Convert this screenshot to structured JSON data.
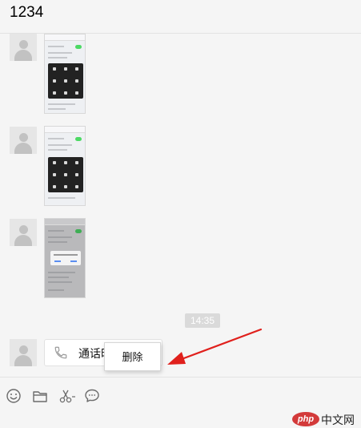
{
  "chat": {
    "title": "1234",
    "timestamp": "14:35",
    "call_message": "通话时长"
  },
  "context_menu": {
    "delete_label": "删除"
  },
  "toolbar": {
    "icons": [
      "emoji-icon",
      "folder-icon",
      "scissors-icon",
      "chat-bubble-icon"
    ]
  },
  "watermark": {
    "logo_text": "php",
    "site_text": "中文网"
  },
  "colors": {
    "window_bg": "#f5f5f5",
    "arrow_red": "#e0201c",
    "toggle_green": "#4cd964",
    "timestamp_bg": "#dadada"
  }
}
